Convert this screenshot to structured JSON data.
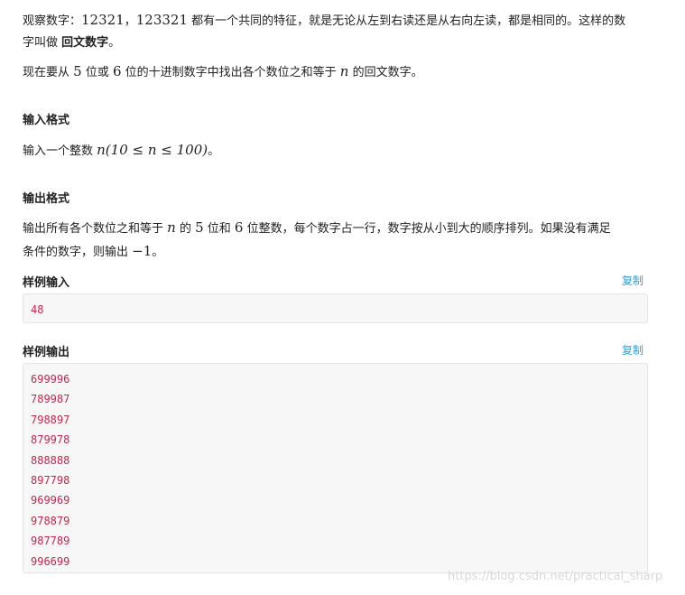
{
  "intro": {
    "part1": "观察数字：",
    "num1": "12321",
    "sep": "，",
    "num2": "123321",
    "part2": " 都有一个共同的特征，就是无论从左到右读还是从右向左读，都是相同的。这样的数",
    "part3": "字叫做 ",
    "term": "回文数字",
    "end": "。"
  },
  "task": {
    "a": "现在要从 ",
    "n5": "5",
    "b": " 位或 ",
    "n6": "6",
    "c": " 位的十进制数字中找出各个数位之和等于 ",
    "var": "n",
    "d": " 的回文数字。"
  },
  "input_format": {
    "heading": "输入格式",
    "a": "输入一个整数 ",
    "math": "n(10 ≤ n ≤ 100)",
    "b": "。"
  },
  "output_format": {
    "heading": "输出格式",
    "a": "输出所有各个数位之和等于 ",
    "var": "n",
    "b": " 的 ",
    "n5": "5",
    "c": " 位和 ",
    "n6": "6",
    "d": " 位整数，每个数字占一行，数字按从小到大的顺序排列。如果没有满足",
    "e": "条件的数字，则输出 ",
    "neg": "−1",
    "f": "。"
  },
  "sample_input": {
    "heading": "样例输入",
    "copy_label": "复制",
    "lines": [
      "48"
    ]
  },
  "sample_output": {
    "heading": "样例输出",
    "copy_label": "复制",
    "lines": [
      "699996",
      "789987",
      "798897",
      "879978",
      "888888",
      "897798",
      "969969",
      "978879",
      "987789",
      "996699"
    ]
  },
  "watermark": "https://blog.csdn.net/practical_sharp",
  "colors": {
    "link": "#2f9ed8",
    "code": "#c7254e",
    "box_bg": "#f7f7f7"
  }
}
